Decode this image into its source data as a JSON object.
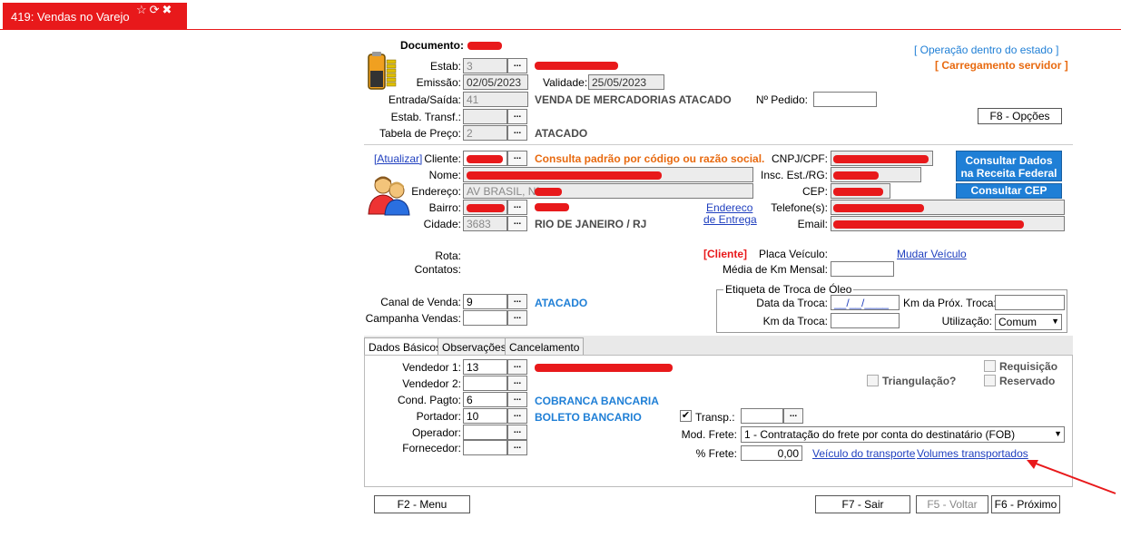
{
  "window": {
    "title": "419: Vendas no Varejo",
    "icons": "☆⟳✖"
  },
  "header": {
    "documento_label": "Documento:",
    "operacao": "[ Operação dentro do estado ]",
    "carregamento": "[ Carregamento servidor ]",
    "estab_label": "Estab:",
    "estab_value": "3",
    "emissao_label": "Emissão:",
    "emissao_value": "02/05/2023",
    "validade_label": "Validade:",
    "validade_value": "25/05/2023",
    "entrada_label": "Entrada/Saída:",
    "entrada_value": "41",
    "entrada_desc": "VENDA DE MERCADORIAS ATACADO",
    "pedido_label": "Nº Pedido:",
    "pedido_value": "",
    "estab_transf_label": "Estab. Transf.:",
    "estab_transf_value": "",
    "tabela_label": "Tabela de Preço:",
    "tabela_value": "2",
    "tabela_desc": "ATACADO",
    "opcoes_button": "F8 - Opções"
  },
  "cliente": {
    "atualizar_link": "[Atualizar]",
    "cliente_label": "Cliente:",
    "cliente_hint": "Consulta padrão por código ou razão social.",
    "nome_label": "Nome:",
    "endereco_label": "Endereço:",
    "endereco_value": "AV BRASIL, Nº",
    "bairro_label": "Bairro:",
    "cidade_label": "Cidade:",
    "cidade_value": "3683",
    "cidade_desc": "RIO DE JANEIRO / RJ",
    "endereco_entrega_link_1": "Endereco",
    "endereco_entrega_link_2": "de Entrega",
    "cnpj_label": "CNPJ/CPF:",
    "insc_label": "Insc. Est./RG:",
    "cep_label": "CEP:",
    "telefone_label": "Telefone(s):",
    "email_label": "Email:",
    "consultar_receita_1": "Consultar Dados",
    "consultar_receita_2": "na Receita Federal",
    "consultar_cep": "Consultar CEP"
  },
  "rota": {
    "rota_label": "Rota:",
    "contatos_label": "Contatos:",
    "cliente_tag": "[Cliente]",
    "placa_label": "Placa Veículo:",
    "mudar_veiculo": "Mudar Veículo",
    "media_km_label": "Média de Km Mensal:"
  },
  "canal": {
    "canal_label": "Canal de Venda:",
    "canal_value": "9",
    "canal_desc": "ATACADO",
    "campanha_label": "Campanha Vendas:"
  },
  "etiqueta": {
    "legend": "Etiqueta de Troca de Óleo",
    "data_troca_label": "Data da Troca:",
    "data_troca_value": "__/__/____",
    "km_prox_label": "Km da Próx. Troca:",
    "km_troca_label": "Km da Troca:",
    "utilizacao_label": "Utilização:",
    "utilizacao_value": "Comum"
  },
  "tabs": [
    "Dados Básicos",
    "Observações",
    "Cancelamento"
  ],
  "dados_basicos": {
    "vendedor1_label": "Vendedor 1:",
    "vendedor1_value": "13",
    "vendedor2_label": "Vendedor 2:",
    "cond_pagto_label": "Cond. Pagto:",
    "cond_pagto_value": "6",
    "cond_pagto_desc": "COBRANCA BANCARIA",
    "portador_label": "Portador:",
    "portador_value": "10",
    "portador_desc": "BOLETO BANCARIO",
    "operador_label": "Operador:",
    "fornecedor_label": "Fornecedor:",
    "requisicao": "Requisição",
    "reservado": "Reservado",
    "triangulacao": "Triangulação?",
    "transp_label": "Transp.:",
    "mod_frete_label": "Mod. Frete:",
    "mod_frete_value": "1 - Contratação do frete por conta do destinatário (FOB)",
    "perc_frete_label": "% Frete:",
    "perc_frete_value": "0,00",
    "veiculo_transporte": "Veículo do transporte",
    "volumes_transportados": "Volumes transportados"
  },
  "footer": {
    "menu": "F2 - Menu",
    "sair": "F7 - Sair",
    "voltar": "F5 - Voltar",
    "proximo": "F6 - Próximo"
  },
  "colors": {
    "accent_red": "#e8191b",
    "link_blue": "#1f7fd6",
    "orange": "#e86a10"
  }
}
